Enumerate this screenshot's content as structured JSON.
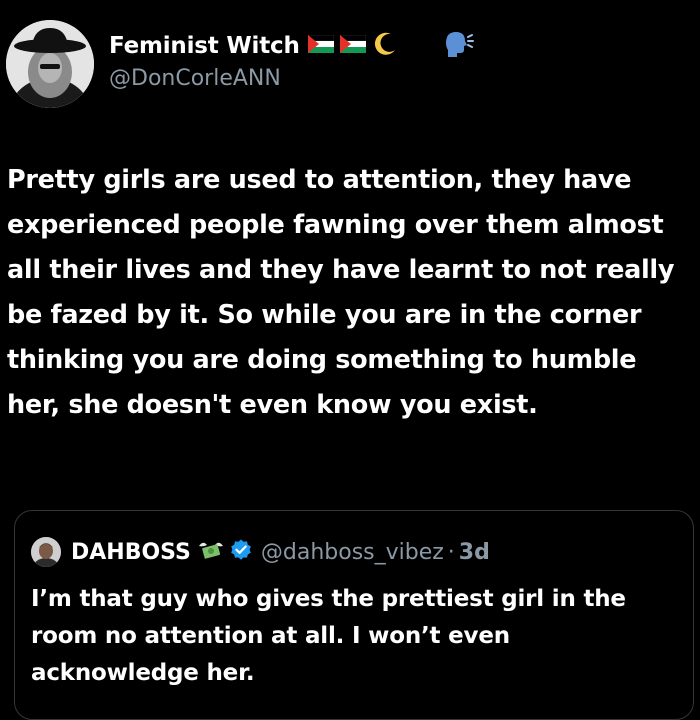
{
  "tweet": {
    "author": {
      "display_name": "Feminist Witch",
      "handle": "@DonCorleANN",
      "badges": [
        "palestine-flag-icon",
        "palestine-flag-icon",
        "crescent-moon-icon",
        "speaking-head-icon"
      ]
    },
    "text": "Pretty girls are used to attention, they have experienced people fawning over them almost all their lives and they have learnt to not really be fazed by it. So while you are in the corner thinking you are doing something to humble her, she doesn't even know you exist."
  },
  "quote": {
    "author": {
      "display_name": "DAHBOSS",
      "handle": "@dahboss_vibez",
      "badges": [
        "money-with-wings-icon",
        "verified-badge-icon"
      ]
    },
    "separator": "·",
    "time": "3d",
    "text": "I’m that guy who gives the prettiest girl in the room no attention at all. I won’t even acknowledge her."
  },
  "colors": {
    "background": "#000000",
    "text": "#ffffff",
    "secondary_text": "#8b98a5",
    "border": "#333639",
    "verified": "#1d9bf0"
  }
}
